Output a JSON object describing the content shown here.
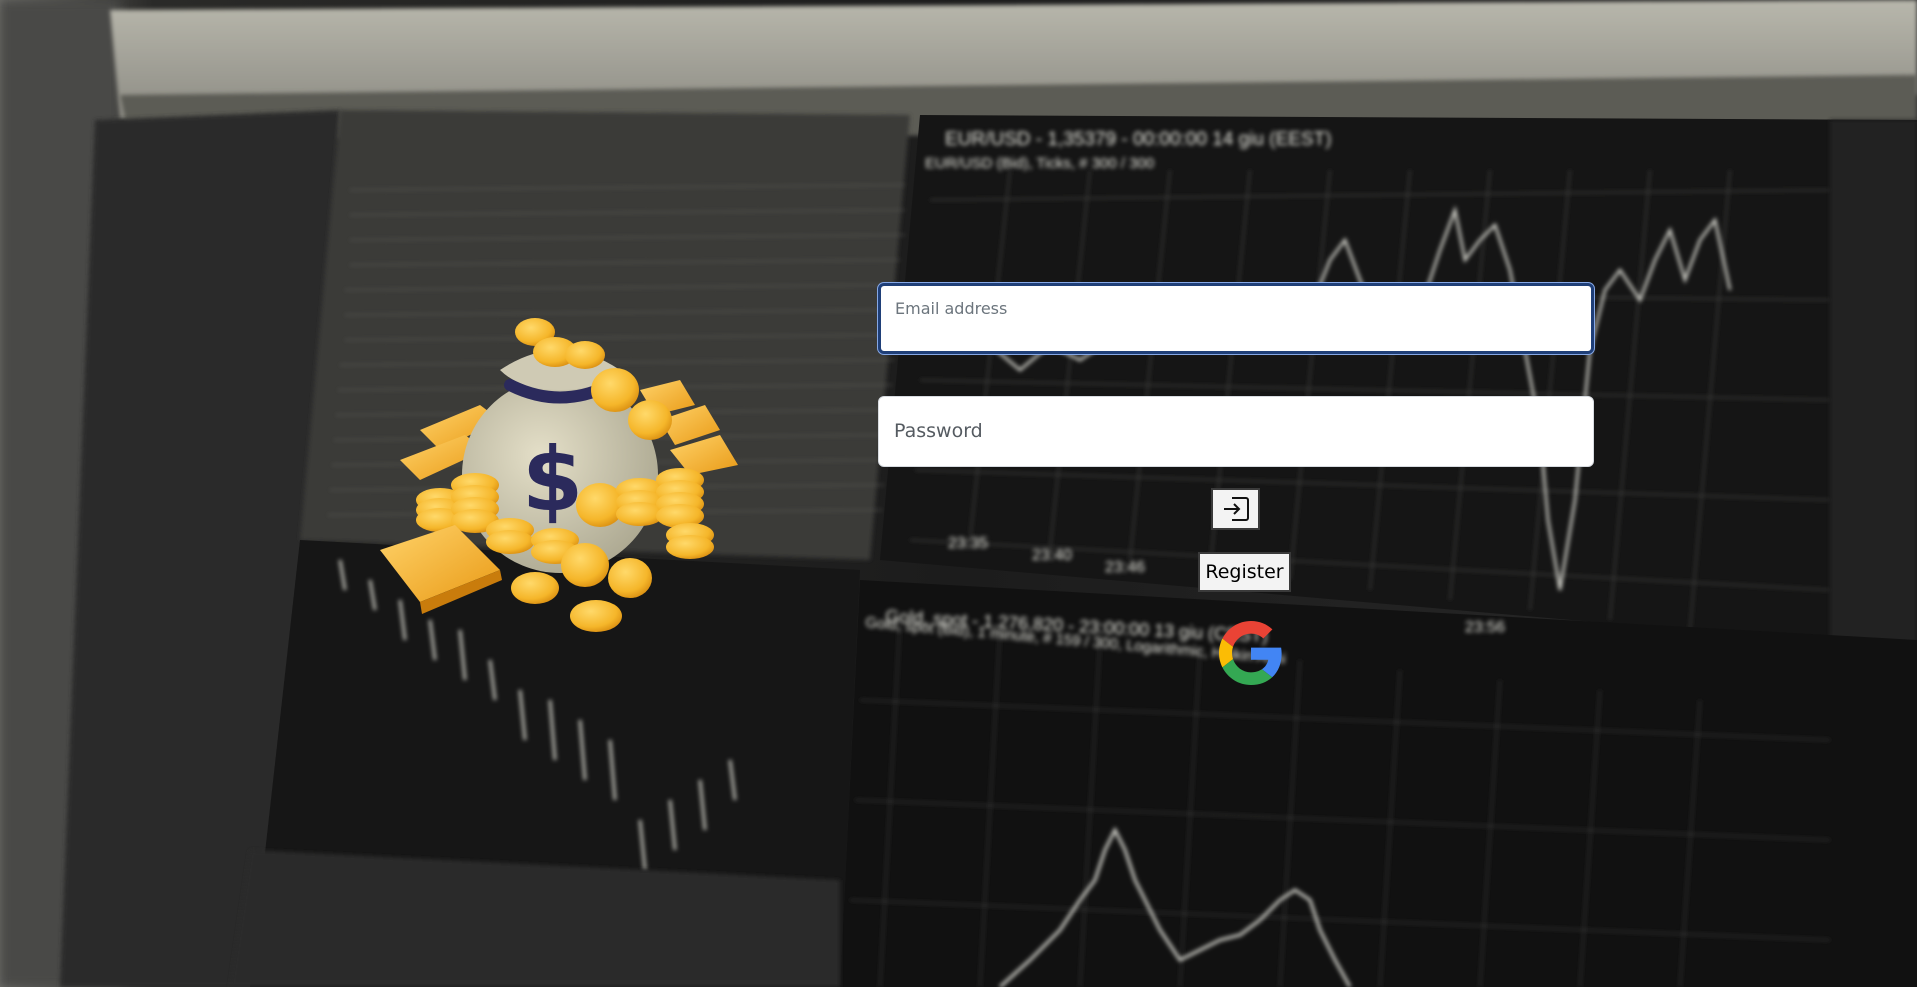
{
  "email": {
    "label": "Email address",
    "value": ""
  },
  "password": {
    "label": "Password",
    "value": ""
  },
  "login_icon": "sign-in-icon",
  "register_label": "Register",
  "google_icon": "google-icon",
  "illustration": "money-bag-with-gold-coins",
  "background": "trading-chart-monitor",
  "colors": {
    "focus_border": "#1f3f78",
    "coin_gold": "#f5b62a",
    "bag": "#cfcab4",
    "dollar_sign": "#2b2a5c"
  },
  "background_text": {
    "chart_top_title": "EUR/USD - 1,35379 - 00:00:00 14 giu (EEST)",
    "chart_top_subtitle": "EUR/USD (Bid), Ticks, # 300 / 300",
    "chart_bottom_title": "Gold, spot - 1.276,820 - 23:00:00 13 giu (CEST)",
    "chart_bottom_subtitle": "Gold, spot (Bid), 1 minute, # 159 / 300, Logarithmic, Heikin Ashi",
    "time_ticks": [
      "23:35",
      "23:40",
      "23:46",
      "23:56"
    ]
  }
}
